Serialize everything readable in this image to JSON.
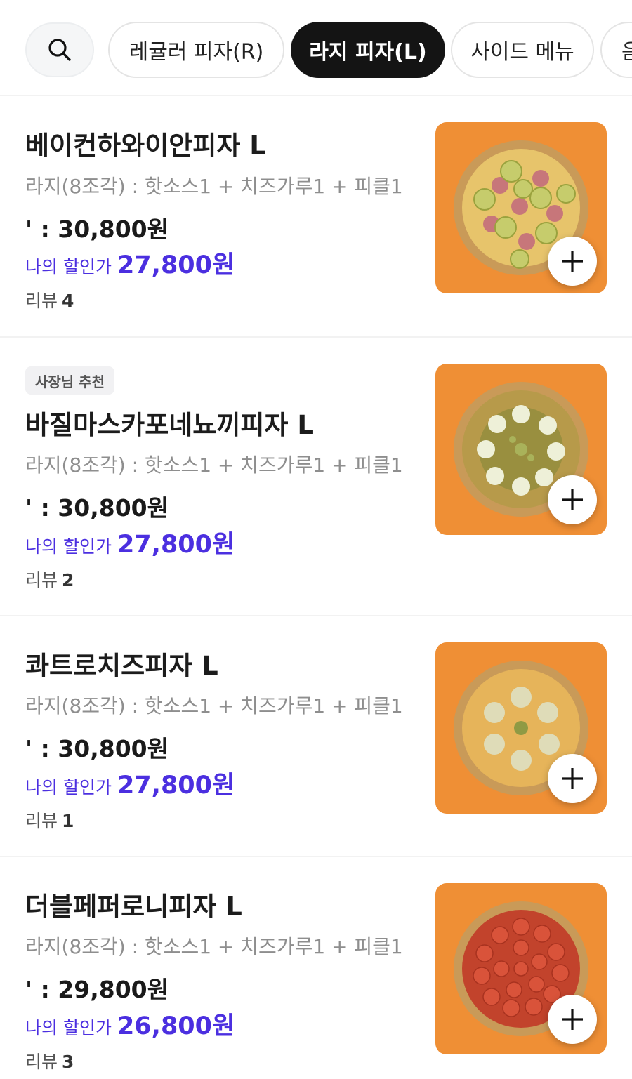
{
  "tabs": [
    {
      "label": "레귤러 피자(R)",
      "active": false
    },
    {
      "label": "라지 피자(L)",
      "active": true
    },
    {
      "label": "사이드 메뉴",
      "active": false
    },
    {
      "label": "음",
      "active": false
    }
  ],
  "items": [
    {
      "badge": "",
      "name": "베이컨하와이안피자 L",
      "desc": "라지(8조각) : 핫소스1 + 치즈가루1 + 피클1",
      "price": "' : 30,800원",
      "discount_label": "나의 할인가",
      "discount_price": "27,800원",
      "review_label": "리뷰",
      "review_count": "4",
      "pizza_icon": "hawaiian-pizza-image"
    },
    {
      "badge": "사장님 추천",
      "name": "바질마스카포네뇨끼피자 L",
      "desc": "라지(8조각) : 핫소스1 + 치즈가루1 + 피클1",
      "price": "' : 30,800원",
      "discount_label": "나의 할인가",
      "discount_price": "27,800원",
      "review_label": "리뷰",
      "review_count": "2",
      "pizza_icon": "basil-gnocchi-pizza-image"
    },
    {
      "badge": "",
      "name": "콰트로치즈피자 L",
      "desc": "라지(8조각) : 핫소스1 + 치즈가루1 + 피클1",
      "price": "' : 30,800원",
      "discount_label": "나의 할인가",
      "discount_price": "27,800원",
      "review_label": "리뷰",
      "review_count": "1",
      "pizza_icon": "quattro-cheese-pizza-image"
    },
    {
      "badge": "",
      "name": "더블페퍼로니피자 L",
      "desc": "라지(8조각) : 핫소스1 + 치즈가루1 + 피클1",
      "price": "' : 29,800원",
      "discount_label": "나의 할인가",
      "discount_price": "26,800원",
      "review_label": "리뷰",
      "review_count": "3",
      "pizza_icon": "double-pepperoni-pizza-image"
    }
  ],
  "colors": {
    "accent": "#4b2fe0",
    "thumb_bg": "#ef8f35",
    "active_tab": "#141414"
  }
}
